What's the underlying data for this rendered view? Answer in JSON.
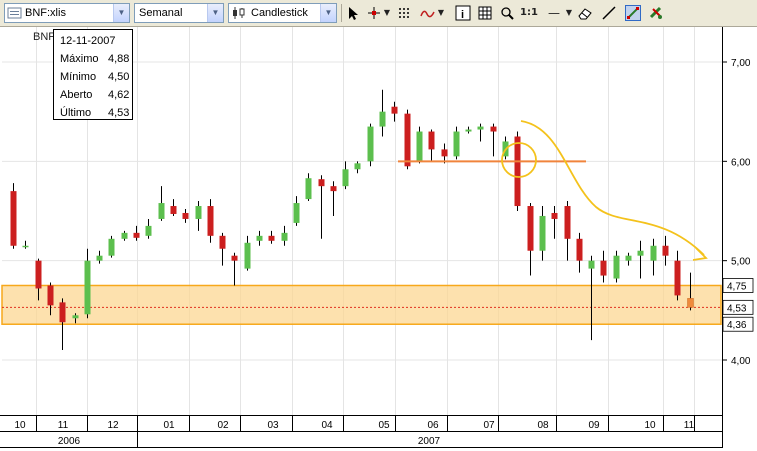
{
  "toolbar": {
    "symbol": "BNF:xlis",
    "period": "Semanal",
    "chart_type": "Candlestick",
    "icons": [
      "pointer-icon",
      "crosshair-icon",
      "grid-icon",
      "indicator-icon",
      "info-icon",
      "grid-toggle-icon",
      "zoom-icon",
      "zoom-1to1-label",
      "line-style-icon",
      "eraser-icon",
      "trend-tool-icon",
      "settings-icon"
    ],
    "zoom_1to1": "1:1",
    "line_style": "—"
  },
  "legend_symbol": "BNF",
  "tooltip": {
    "date": "12-11-2007",
    "rows": [
      {
        "label": "Máximo",
        "value": "4,88"
      },
      {
        "label": "Mínimo",
        "value": "4,50"
      },
      {
        "label": "Aberto",
        "value": "4,62"
      },
      {
        "label": "Último",
        "value": "4,53"
      }
    ]
  },
  "colors": {
    "up": "#5cbf4e",
    "down": "#cc1f1f",
    "support_band": "#fcd793",
    "support_border": "#f7a81b",
    "resistance_line": "#f0843c",
    "projection": "#f4c21c",
    "last_candle": "#ef8a3c"
  },
  "chart_data": {
    "type": "candlestick",
    "ylim": [
      3.5,
      7.3
    ],
    "y_ticks": [
      "7,00",
      "6,00",
      "5,00",
      "4,00"
    ],
    "y_tick_values": [
      7.0,
      6.0,
      5.0,
      4.0
    ],
    "price_markers": [
      {
        "label": "4,75",
        "value": 4.75
      },
      {
        "label": "4,53",
        "value": 4.53
      },
      {
        "label": "4,36",
        "value": 4.36
      }
    ],
    "support_band": [
      4.36,
      4.75
    ],
    "last_price_line": 4.53,
    "resistance_line": 6.0,
    "x_month_labels": [
      "10",
      "11",
      "12",
      "01",
      "02",
      "03",
      "04",
      "05",
      "06",
      "07",
      "08",
      "09",
      "10",
      "11"
    ],
    "x_year_labels": [
      "2006",
      "2007"
    ],
    "candles": [
      {
        "o": 5.7,
        "h": 5.78,
        "c": 5.15,
        "l": 5.12
      },
      {
        "o": 5.15,
        "h": 5.2,
        "c": 5.15,
        "l": 5.12
      },
      {
        "o": 5.0,
        "h": 5.02,
        "c": 4.72,
        "l": 4.6
      },
      {
        "o": 4.75,
        "h": 4.78,
        "c": 4.55,
        "l": 4.45
      },
      {
        "o": 4.58,
        "h": 4.62,
        "c": 4.38,
        "l": 4.1
      },
      {
        "o": 4.42,
        "h": 4.47,
        "c": 4.45,
        "l": 4.37
      },
      {
        "o": 4.46,
        "h": 5.12,
        "c": 5.0,
        "l": 4.42
      },
      {
        "o": 5.0,
        "h": 5.1,
        "c": 5.05,
        "l": 4.97
      },
      {
        "o": 5.05,
        "h": 5.25,
        "c": 5.22,
        "l": 5.03
      },
      {
        "o": 5.22,
        "h": 5.3,
        "c": 5.28,
        "l": 5.2
      },
      {
        "o": 5.28,
        "h": 5.35,
        "c": 5.23,
        "l": 5.2
      },
      {
        "o": 5.25,
        "h": 5.42,
        "c": 5.35,
        "l": 5.22
      },
      {
        "o": 5.42,
        "h": 5.75,
        "c": 5.58,
        "l": 5.4
      },
      {
        "o": 5.55,
        "h": 5.62,
        "c": 5.47,
        "l": 5.45
      },
      {
        "o": 5.48,
        "h": 5.52,
        "c": 5.42,
        "l": 5.38
      },
      {
        "o": 5.42,
        "h": 5.6,
        "c": 5.55,
        "l": 5.3
      },
      {
        "o": 5.55,
        "h": 5.62,
        "c": 5.25,
        "l": 5.18
      },
      {
        "o": 5.25,
        "h": 5.28,
        "c": 5.12,
        "l": 4.95
      },
      {
        "o": 5.05,
        "h": 5.08,
        "c": 5.0,
        "l": 4.75
      },
      {
        "o": 4.92,
        "h": 5.25,
        "c": 5.18,
        "l": 4.9
      },
      {
        "o": 5.2,
        "h": 5.3,
        "c": 5.25,
        "l": 5.15
      },
      {
        "o": 5.25,
        "h": 5.3,
        "c": 5.2,
        "l": 5.17
      },
      {
        "o": 5.2,
        "h": 5.35,
        "c": 5.28,
        "l": 5.15
      },
      {
        "o": 5.38,
        "h": 5.65,
        "c": 5.58,
        "l": 5.35
      },
      {
        "o": 5.62,
        "h": 5.88,
        "c": 5.83,
        "l": 5.6
      },
      {
        "o": 5.82,
        "h": 5.86,
        "c": 5.75,
        "l": 5.22
      },
      {
        "o": 5.75,
        "h": 5.8,
        "c": 5.7,
        "l": 5.45
      },
      {
        "o": 5.75,
        "h": 6.0,
        "c": 5.92,
        "l": 5.72
      },
      {
        "o": 5.92,
        "h": 6.0,
        "c": 5.98,
        "l": 5.88
      },
      {
        "o": 6.0,
        "h": 6.38,
        "c": 6.35,
        "l": 5.95
      },
      {
        "o": 6.35,
        "h": 6.72,
        "c": 6.5,
        "l": 6.25
      },
      {
        "o": 6.55,
        "h": 6.6,
        "c": 6.48,
        "l": 6.4
      },
      {
        "o": 6.48,
        "h": 6.52,
        "c": 5.95,
        "l": 5.92
      },
      {
        "o": 6.0,
        "h": 6.35,
        "c": 6.3,
        "l": 5.98
      },
      {
        "o": 6.3,
        "h": 6.32,
        "c": 6.12,
        "l": 6.0
      },
      {
        "o": 6.12,
        "h": 6.18,
        "c": 6.05,
        "l": 5.98
      },
      {
        "o": 6.05,
        "h": 6.35,
        "c": 6.3,
        "l": 6.02
      },
      {
        "o": 6.3,
        "h": 6.35,
        "c": 6.32,
        "l": 6.28
      },
      {
        "o": 6.32,
        "h": 6.38,
        "c": 6.35,
        "l": 6.2
      },
      {
        "o": 6.35,
        "h": 6.38,
        "c": 6.3,
        "l": 6.05
      },
      {
        "o": 6.05,
        "h": 6.25,
        "c": 6.2,
        "l": 6.02
      },
      {
        "o": 6.25,
        "h": 6.3,
        "c": 5.55,
        "l": 5.5
      },
      {
        "o": 5.55,
        "h": 5.58,
        "c": 5.1,
        "l": 4.85
      },
      {
        "o": 5.1,
        "h": 5.55,
        "c": 5.45,
        "l": 5.0
      },
      {
        "o": 5.48,
        "h": 5.55,
        "c": 5.42,
        "l": 5.22
      },
      {
        "o": 5.55,
        "h": 5.6,
        "c": 5.22,
        "l": 5.0
      },
      {
        "o": 5.22,
        "h": 5.28,
        "c": 5.0,
        "l": 4.88
      },
      {
        "o": 4.92,
        "h": 5.05,
        "c": 5.0,
        "l": 4.2
      },
      {
        "o": 5.0,
        "h": 5.1,
        "c": 4.85,
        "l": 4.78
      },
      {
        "o": 4.82,
        "h": 5.1,
        "c": 5.05,
        "l": 4.78
      },
      {
        "o": 5.0,
        "h": 5.08,
        "c": 5.05,
        "l": 4.95
      },
      {
        "o": 5.05,
        "h": 5.2,
        "c": 5.1,
        "l": 4.82
      },
      {
        "o": 5.0,
        "h": 5.22,
        "c": 5.15,
        "l": 4.85
      },
      {
        "o": 5.15,
        "h": 5.25,
        "c": 5.05,
        "l": 4.95
      },
      {
        "o": 5.0,
        "h": 5.1,
        "c": 4.65,
        "l": 4.6
      },
      {
        "o": 4.62,
        "h": 4.88,
        "c": 4.53,
        "l": 4.5
      }
    ]
  }
}
